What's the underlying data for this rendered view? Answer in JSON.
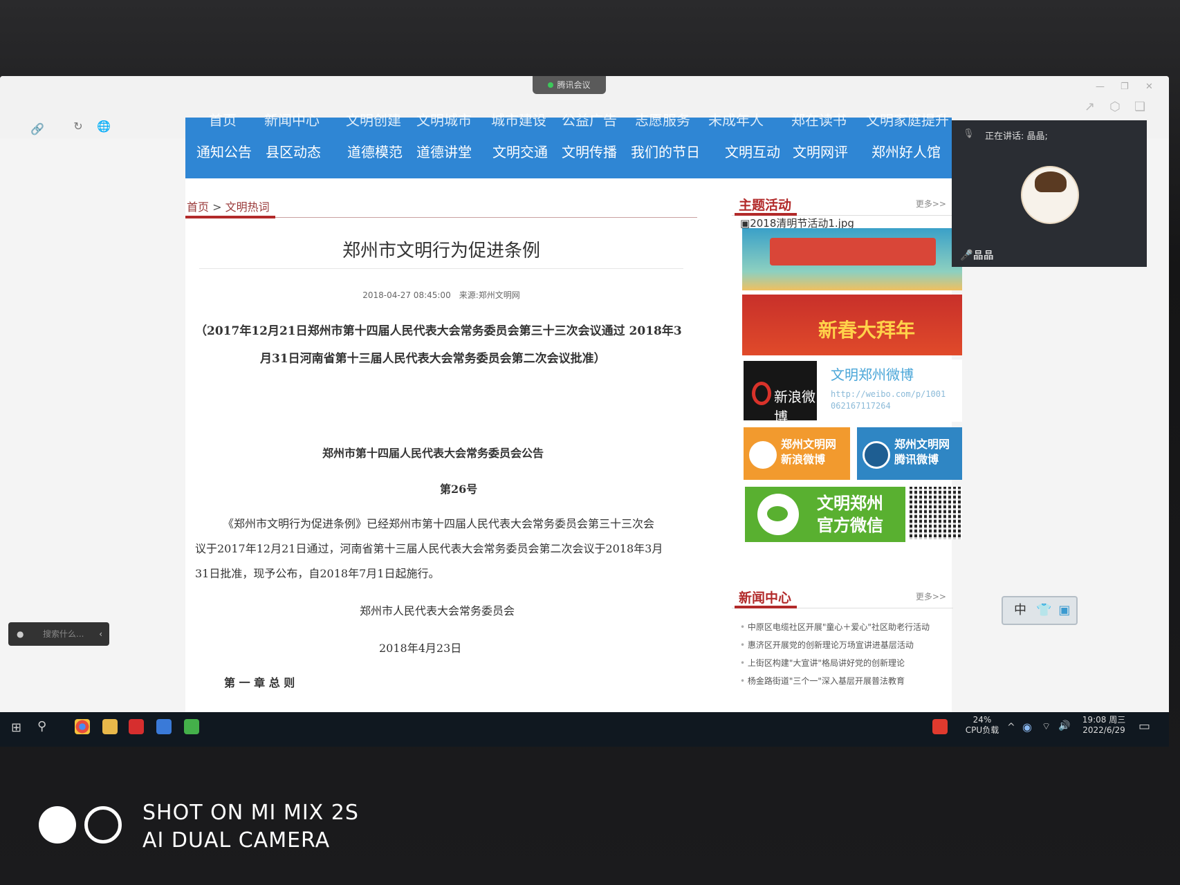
{
  "meeting_tab": "腾讯会议",
  "nav": {
    "row1": [
      "首页",
      "新闻中心",
      "文明创建",
      "文明城市",
      "城市建设",
      "公益广告",
      "志愿服务",
      "未成年人",
      "郑在读书",
      "文明家庭提升"
    ],
    "row2": [
      "通知公告",
      "县区动态",
      "道德模范",
      "道德讲堂",
      "文明交通",
      "文明传播",
      "我们的节日",
      "文明互动",
      "文明网评",
      "郑州好人馆"
    ]
  },
  "breadcrumb": {
    "home": "首页",
    "sep": ">",
    "current": "文明热词"
  },
  "article": {
    "title": "郑州市文明行为促进条例",
    "meta": "2018-04-27 08:45:00　来源:郑州文明网",
    "preamble_line1": "（2017年12月21日郑州市第十四届人民代表大会常务委员会第三十三次会议通过 2018年3",
    "preamble_line2": "月31日河南省第十三届人民代表大会常务委员会第二次会议批准）",
    "notice_title": "郑州市第十四届人民代表大会常务委员会公告",
    "notice_no": "第26号",
    "body_line1": "《郑州市文明行为促进条例》已经郑州市第十四届人民代表大会常务委员会第三十三次会",
    "body_line2": "议于2017年12月21日通过，河南省第十三届人民代表大会常务委员会第二次会议于2018年3月",
    "body_line3": "31日批准，现予公布，自2018年7月1日起施行。",
    "signer": "郑州市人民代表大会常务委员会",
    "date": "2018年4月23日",
    "chapter": "第 一 章 总 则"
  },
  "sidebar": {
    "theme_title": "主题活动",
    "more": "更多>>",
    "image_caption": "2018清明节活动1.jpg",
    "banner2_text": "新春大拜年",
    "weibo_logo_text": "新浪微博",
    "weibo_name": "文明郑州微博",
    "weibo_url_line1": "http://weibo.com/p/1001",
    "weibo_url_line2": "062167117264",
    "sina_btn": [
      "郑州文明网",
      "新浪微博"
    ],
    "tencent_btn": [
      "郑州文明网",
      "腾讯微博"
    ],
    "wechat_btn": [
      "文明郑州",
      "官方微信"
    ],
    "news_title": "新闻中心",
    "news_more": "更多>>",
    "news_items": [
      "中原区电缆社区开展\"童心＋爱心\"社区助老行活动",
      "惠济区开展党的创新理论万场宣讲进基层活动",
      "上街区构建\"大宣讲\"格局讲好党的创新理论",
      "杨金路街道\"三个一\"深入基层开展普法教育"
    ]
  },
  "video": {
    "speaking": "正在讲话: 晶晶;",
    "name": "晶晶"
  },
  "ime": "中",
  "search_pill": "搜索什么...",
  "taskbar": {
    "cpu_pct": "24%",
    "cpu_label": "CPU负载",
    "time": "19:08 周三",
    "date": "2022/6/29"
  },
  "watermark": {
    "line1": "SHOT ON MI MIX 2S",
    "line2": "AI DUAL CAMERA"
  }
}
